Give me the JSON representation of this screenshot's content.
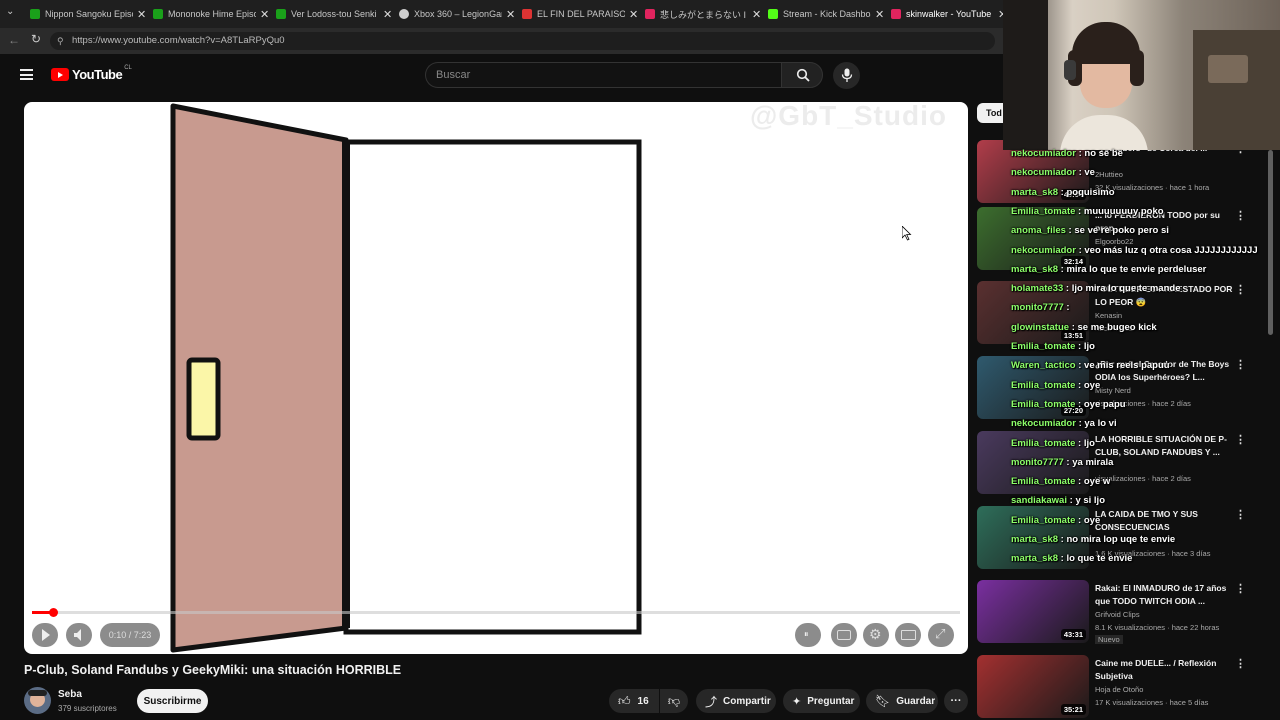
{
  "browser": {
    "tabs": [
      {
        "title": "Nippon Sangoku Episo",
        "color": "#1aa01a"
      },
      {
        "title": "Mononoke Hime Episo",
        "color": "#1aa01a"
      },
      {
        "title": "Ver Lodoss-tou Senki O",
        "color": "#1aa01a"
      },
      {
        "title": "Xbox 360 – LegionGam",
        "color": "#cfcfcf"
      },
      {
        "title": "EL FIN DEL PARAISO - C",
        "color": "#d33"
      },
      {
        "title": "悲しみがとまらない I CAI",
        "color": "#e0245e"
      },
      {
        "title": "Stream - Kick Dashboa",
        "color": "#53fc18"
      },
      {
        "title": "skinwalker - YouTube",
        "color": "#e0245e"
      }
    ],
    "url": "https://www.youtube.com/watch?v=A8TLaRPyQu0"
  },
  "header": {
    "logo": "YouTube",
    "country": "CL",
    "search_placeholder": "Buscar"
  },
  "player": {
    "watermark": "@GbT_Studio",
    "time": "0:10 / 7:23",
    "progress_fraction": 0.023
  },
  "video": {
    "title": "P-Club, Soland Fandubs y GeekyMiki: una situación HORRIBLE",
    "channel": "Seba",
    "subscribers": "379 suscriptores",
    "subscribe_label": "Suscribirme",
    "likes": "16",
    "share_label": "Compartir",
    "ask_label": "Preguntar",
    "save_label": "Guardar"
  },
  "chips": {
    "first": "Tod"
  },
  "recommendations": [
    {
      "title": "\"Youtubers\" de Corea del ...",
      "channel": "2Huttieo",
      "meta": "32 K visualizaciones · hace 1 hora",
      "duration": "49:04",
      "thumb": "#b13d4a"
    },
    {
      "title": "... lo PERDIERON TODO por su prop...",
      "channel": "Elgoorbo22",
      "meta": "",
      "duration": "32:14",
      "thumb": "#3c6e2e"
    },
    {
      "title": "YOUTUBER ES ARRESTADO POR LO PEOR 😨",
      "channel": "Kenasin",
      "meta": "hace 4 días",
      "duration": "13:51",
      "thumb": "#5a3030"
    },
    {
      "title": "¿Por qué el Creador de The Boys ODIA los Superhéroes? L...",
      "channel": "Misty Nerd",
      "meta": "visualizaciones · hace 2 días",
      "duration": "27:20",
      "thumb": "#2f5a6e"
    },
    {
      "title": "LA HORRIBLE SITUACIÓN DE P-CLUB, SOLAND FANDUBS Y ...",
      "channel": "",
      "meta": "visualizaciones · hace 2 días",
      "duration": "",
      "thumb": "#4a3a5e"
    },
    {
      "title": "LA CAIDA DE TMO Y SUS CONSECUENCIAS",
      "channel": "",
      "meta": "1.6 K visualizaciones · hace 3 días",
      "duration": "",
      "thumb": "#2e6e5a"
    },
    {
      "title": "Rakai: El INMADURO de 17 años que TODO TWITCH ODIA ...",
      "channel": "Grifvoid Clips",
      "meta": "8.1 K visualizaciones · hace 22 horas",
      "duration": "43:31",
      "thumb": "#7a2fa0",
      "badge": "Nuevo"
    },
    {
      "title": "Caine me DUELE... / Reflexión Subjetiva",
      "channel": "Hoja de Otoño",
      "meta": "17 K visualizaciones · hace 5 días",
      "duration": "35:21",
      "thumb": "#a33030"
    }
  ],
  "chat": [
    {
      "user": "nekocumiador",
      "text": "no se be"
    },
    {
      "user": "nekocumiador",
      "text": "ve"
    },
    {
      "user": "marta_sk8",
      "text": "poquisimo"
    },
    {
      "user": "Emilia_tomate",
      "text": "muuuuuuuy poko"
    },
    {
      "user": "anoma_files",
      "text": "se ve re poko pero si"
    },
    {
      "user": "nekocumiador",
      "text": "veo más luz q otra cosa JJJJJJJJJJJJ"
    },
    {
      "user": "marta_sk8",
      "text": "mira lo que te envie perdeluser"
    },
    {
      "user": "holamate33",
      "text": "ljo mira lo que te mande"
    },
    {
      "user": "monito7777",
      "text": ""
    },
    {
      "user": "glowinstatue",
      "text": "se me bugeo kick"
    },
    {
      "user": "Emilia_tomate",
      "text": "ljo"
    },
    {
      "user": "Waren_tactico",
      "text": "ve mis reels papuu"
    },
    {
      "user": "Emilia_tomate",
      "text": "oye"
    },
    {
      "user": "Emilia_tomate",
      "text": "oye papu"
    },
    {
      "user": "nekocumiador",
      "text": "ya lo vi"
    },
    {
      "user": "Emilia_tomate",
      "text": "ljo"
    },
    {
      "user": "monito7777",
      "text": "ya mirala"
    },
    {
      "user": "Emilia_tomate",
      "text": "oye w"
    },
    {
      "user": "sandiakawai",
      "text": "y si ljo"
    },
    {
      "user": "Emilia_tomate",
      "text": "oye"
    },
    {
      "user": "marta_sk8",
      "text": "no mira lop uqe te envie"
    },
    {
      "user": "marta_sk8",
      "text": "lo que te envie"
    }
  ],
  "colors": {
    "accent": "#ff0000",
    "chat_user": "#8dff6a",
    "door": "#c89a8f",
    "door_window": "#fbf6a8"
  }
}
